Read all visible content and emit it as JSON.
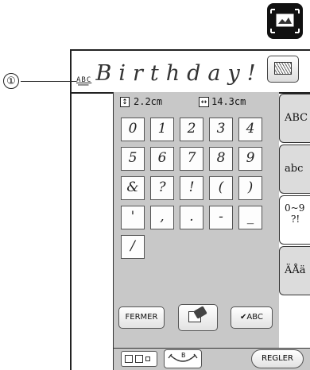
{
  "callout": {
    "number": "①"
  },
  "display": {
    "text": "_Birthday!",
    "small_preview": "ABC"
  },
  "size": {
    "height_value": "2.2cm",
    "width_value": "14.3cm",
    "height_icon": "↕",
    "width_icon": "↔"
  },
  "keys": [
    [
      "0",
      "1",
      "2",
      "3",
      "4"
    ],
    [
      "5",
      "6",
      "7",
      "8",
      "9"
    ],
    [
      "&",
      "?",
      "!",
      "(",
      ")"
    ],
    [
      "'",
      ",",
      ".",
      "-",
      "_"
    ],
    [
      "/"
    ]
  ],
  "buttons": {
    "close_label": "FERMER",
    "check_label": "✔ABC",
    "set_label": "REGLER"
  },
  "tabs": {
    "upper": "ABC",
    "lower": "abc",
    "num_line1": "0~9",
    "num_line2": "?!",
    "accent": "ÄÅä"
  },
  "icons": {
    "corner": "image-frame-icon",
    "view": "embroidery-view-icon",
    "eraser": "eraser-icon",
    "layout": "layout-arrangement-icon",
    "curve": "arc-text-icon"
  },
  "curve_label": "B"
}
